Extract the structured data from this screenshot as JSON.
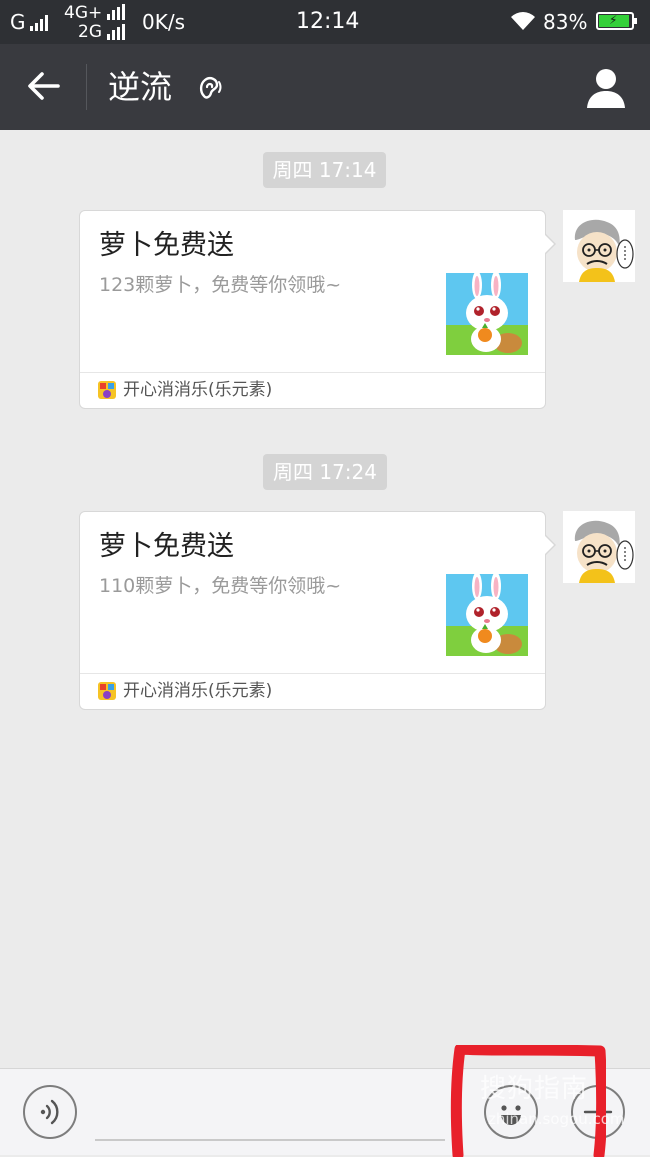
{
  "status_bar": {
    "carrier1": "G",
    "network": "4G+",
    "network2": "2G",
    "speed": "0K/s",
    "time": "12:14",
    "battery": "83%"
  },
  "header": {
    "title": "逆流",
    "back_icon": "arrow-left-icon",
    "ear_icon": "ear-icon",
    "profile_icon": "person-icon"
  },
  "messages": [
    {
      "timestamp": "周四 17:14",
      "title": "萝卜免费送",
      "description": "123颗萝卜，免费等你领哦~",
      "app_name": "开心消消乐(乐元素)"
    },
    {
      "timestamp": "周四 17:24",
      "title": "萝卜免费送",
      "description": "110颗萝卜，免费等你领哦~",
      "app_name": "开心消消乐(乐元素)"
    }
  ],
  "input_bar": {
    "voice_icon": "voice-icon",
    "emoji_icon": "emoji-icon",
    "plus_icon": "plus-icon"
  },
  "watermark": {
    "text": "搜狗指南",
    "url": "zhinan.sogou.com"
  },
  "colors": {
    "header_bg": "#393a3f",
    "statusbar_bg": "#2e3034",
    "chat_bg": "#ebebeb",
    "annotation": "#e8202a"
  }
}
